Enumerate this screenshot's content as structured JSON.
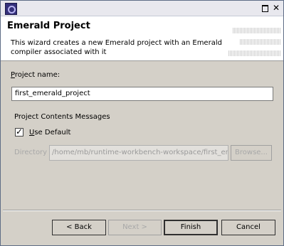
{
  "window": {
    "title": ""
  },
  "header": {
    "title": "Emerald Project",
    "description": "This wizard creates a new Emerald project with an Emerald compiler associated with it"
  },
  "form": {
    "project_name_label_first": "P",
    "project_name_label_rest": "roject name:",
    "project_name_value": "first_emerald_project",
    "group_label": "Project Contents Messages",
    "use_default_label_first": "U",
    "use_default_label_rest": "se Default",
    "use_default_checked": true,
    "directory_label": "Directory",
    "directory_value": "/home/mb/runtime-workbench-workspace/first_emerald_project",
    "browse_label": "Browse..."
  },
  "buttons": {
    "back": "< Back",
    "next": "Next >",
    "finish": "Finish",
    "cancel": "Cancel"
  }
}
